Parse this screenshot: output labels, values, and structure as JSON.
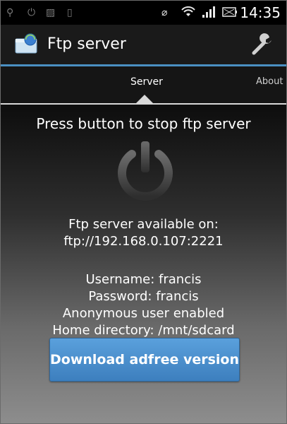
{
  "status_bar": {
    "time": "14:35",
    "icons": [
      "usb-icon",
      "power-icon",
      "image-icon",
      "phone-icon",
      "vibrate-icon",
      "wifi-icon",
      "signal-icon",
      "battery-icon"
    ]
  },
  "action_bar": {
    "title": "Ftp server",
    "icon": "ftp-app-icon",
    "settings_icon": "wrench-icon"
  },
  "tabs": [
    {
      "label": "Server",
      "selected": true
    },
    {
      "label": "About",
      "selected": false
    }
  ],
  "server": {
    "instruction": "Press button to stop ftp server",
    "available_label": "Ftp server available on:",
    "url": "ftp://192.168.0.107:2221",
    "username": "Username: francis",
    "password": "Password: francis",
    "anonymous": "Anonymous user enabled",
    "home_directory": "Home directory: /mnt/sdcard",
    "download_button": "Download adfree version"
  },
  "colors": {
    "accent": "#4a90c2",
    "button": "#4a8ccc"
  }
}
